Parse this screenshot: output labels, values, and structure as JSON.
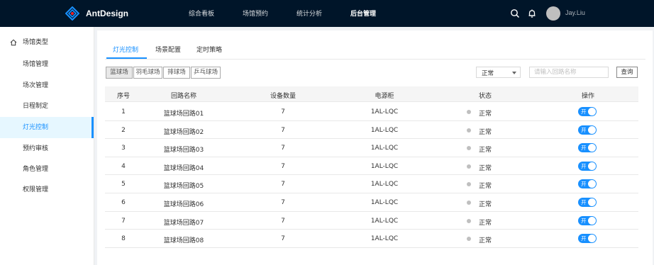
{
  "header": {
    "brand": "AntDesign",
    "nav": [
      "综合看板",
      "场馆预约",
      "统计分析",
      "后台管理"
    ],
    "active_nav": "后台管理",
    "username": "Jay.Liu"
  },
  "sidebar": {
    "items": [
      "场馆类型",
      "场馆管理",
      "场次管理",
      "日程制定",
      "灯光控制",
      "预约审核",
      "角色管理",
      "权限管理"
    ],
    "active": "灯光控制"
  },
  "tabs": [
    "灯光控制",
    "场景配置",
    "定时策略"
  ],
  "active_tab": "灯光控制",
  "categories": [
    "篮球场",
    "羽毛球场",
    "排球场",
    "乒乓球场"
  ],
  "active_category": "篮球场",
  "filter": {
    "status_value": "正常",
    "search_placeholder": "请输入回路名称",
    "query_label": "查询"
  },
  "table": {
    "columns": [
      "序号",
      "回路名称",
      "设备数量",
      "电源柜",
      "状态",
      "操作"
    ],
    "rows": [
      {
        "index": "1",
        "name": "篮球场回路01",
        "devices": "7",
        "cabinet": "1AL-LQC",
        "status": "正常",
        "switch": "开"
      },
      {
        "index": "2",
        "name": "篮球场回路02",
        "devices": "7",
        "cabinet": "1AL-LQC",
        "status": "正常",
        "switch": "开"
      },
      {
        "index": "3",
        "name": "篮球场回路03",
        "devices": "7",
        "cabinet": "1AL-LQC",
        "status": "正常",
        "switch": "开"
      },
      {
        "index": "4",
        "name": "篮球场回路04",
        "devices": "7",
        "cabinet": "1AL-LQC",
        "status": "正常",
        "switch": "开"
      },
      {
        "index": "5",
        "name": "篮球场回路05",
        "devices": "7",
        "cabinet": "1AL-LQC",
        "status": "正常",
        "switch": "开"
      },
      {
        "index": "6",
        "name": "篮球场回路06",
        "devices": "7",
        "cabinet": "1AL-LQC",
        "status": "正常",
        "switch": "开"
      },
      {
        "index": "7",
        "name": "篮球场回路07",
        "devices": "7",
        "cabinet": "1AL-LQC",
        "status": "正常",
        "switch": "开"
      },
      {
        "index": "8",
        "name": "篮球场回路08",
        "devices": "7",
        "cabinet": "1AL-LQC",
        "status": "正常",
        "switch": "开"
      }
    ]
  },
  "colors": {
    "header_bg": "#001529",
    "primary": "#1890ff",
    "status_dot": "#bfbfbf"
  }
}
